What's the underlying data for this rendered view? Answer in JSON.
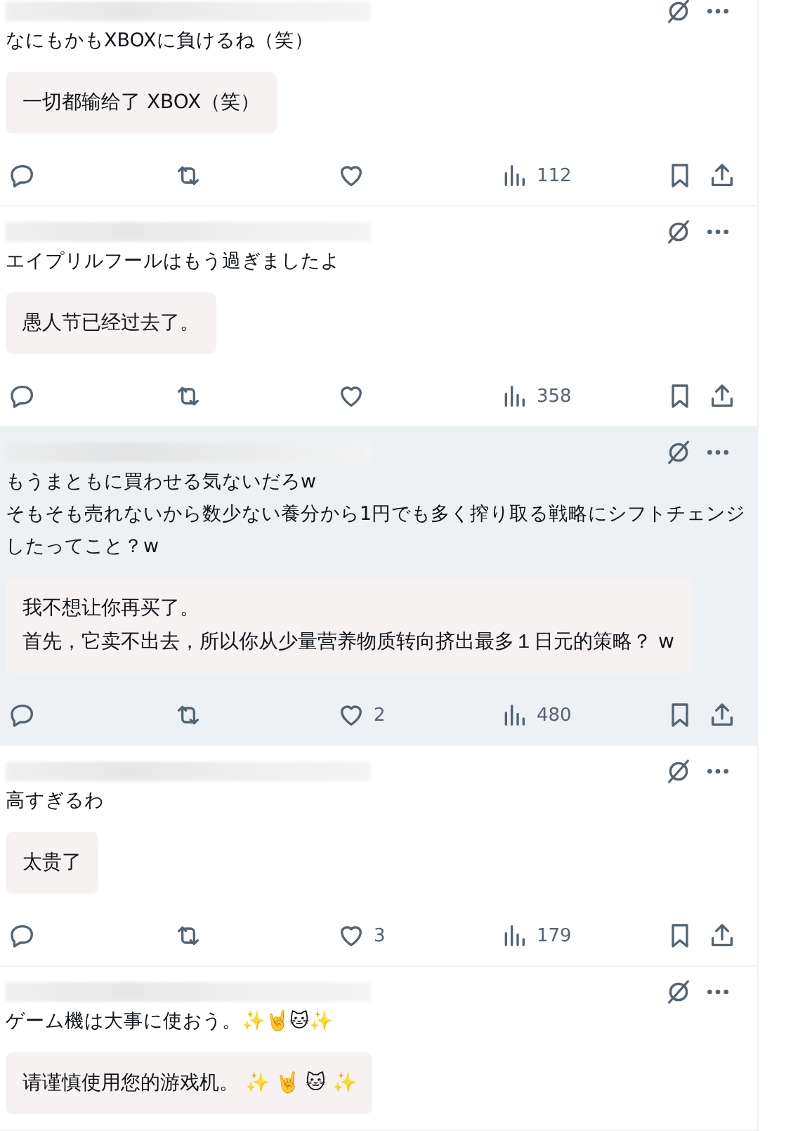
{
  "tweets": [
    {
      "highlighted": false,
      "lines": [
        "なにもかもXBOXに負けるね（笑）"
      ],
      "translation_lines": [
        "一切都输给了 XBOX（笑）"
      ],
      "views": "112"
    },
    {
      "highlighted": false,
      "lines": [
        "エイプリルフールはもう過ぎましたよ"
      ],
      "translation_lines": [
        "愚人节已经过去了。"
      ],
      "views": "358"
    },
    {
      "highlighted": true,
      "lines": [
        "もうまともに買わせる気ないだろw",
        "そもそも売れないから数少ない養分から1円でも多く搾り取る戦略にシフトチェンジしたってこと？w"
      ],
      "translation_lines": [
        "我不想让你再买了。",
        "首先，它卖不出去，所以你从少量营养物质转向挤出最多１日元的策略？ w"
      ],
      "likes": "2",
      "views": "480"
    },
    {
      "highlighted": false,
      "lines": [
        "高すぎるわ"
      ],
      "translation_lines": [
        "太贵了"
      ],
      "likes": "3",
      "views": "179"
    },
    {
      "highlighted": false,
      "lines": [
        "ゲーム機は大事に使おう。✨🤘🐱✨"
      ],
      "translation_lines": [
        "请谨慎使用您的游戏机。 ✨ 🤘 🐱 ✨"
      ]
    }
  ]
}
